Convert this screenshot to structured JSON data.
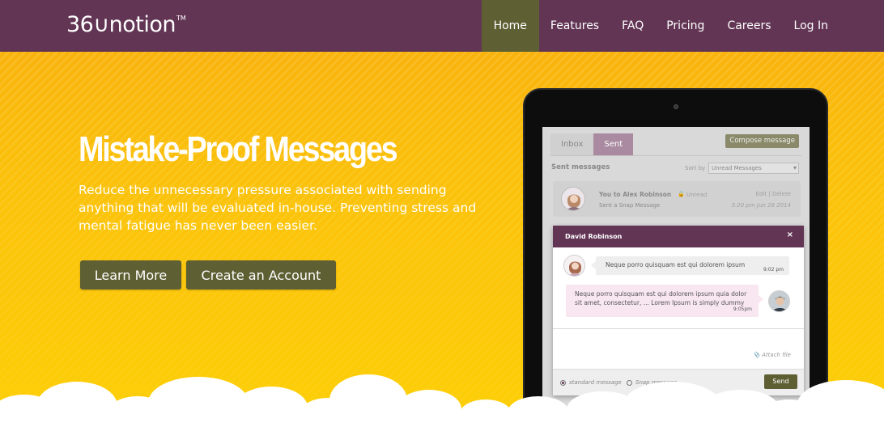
{
  "nav": {
    "logo": "36∪notion",
    "logo_tm": "TM",
    "items": [
      {
        "label": "Home",
        "active": true
      },
      {
        "label": "Features"
      },
      {
        "label": "FAQ"
      },
      {
        "label": "Pricing"
      },
      {
        "label": "Careers"
      },
      {
        "label": "Log In"
      }
    ]
  },
  "hero": {
    "headline": "Mistake-Proof Messages",
    "subtext": "Reduce the unnecessary pressure associated with sending anything that will be evaluated in-house. Preventing stress and mental fatigue has never been easier.",
    "learn_more": "Learn More",
    "create_account": "Create an Account"
  },
  "app": {
    "tabs": [
      "Inbox",
      "Sent"
    ],
    "compose": "Compose message",
    "sent_title": "Sent messages",
    "sort_label": "Sort by",
    "sort_value": "Unread Messages",
    "message": {
      "from": "You to Alex Robinson",
      "status": "Unread",
      "subject": "Sent a Snap Message",
      "actions": "Edit | Delete",
      "date": "3:20 pm Jun 28 2014"
    },
    "chat": {
      "name": "David Robinson",
      "close": "×",
      "msg1_text": "Neque porro quisquam est qui dolorem ipsum",
      "msg1_time": "9:02 pm",
      "msg2_text": "Neque porro quisquam est qui dolorem ipsum quia dolor sit amet, consectetur, ... Lorem Ipsum is simply dummy",
      "msg2_time": "9:05pm",
      "attach": "Attach file",
      "radio1": "standard message",
      "radio2": "Snap message",
      "send": "Send"
    }
  },
  "colors": {
    "nav_bg": "#623554",
    "accent_olive": "#5e5f33",
    "hero_yellow": "#fbbc0b"
  }
}
